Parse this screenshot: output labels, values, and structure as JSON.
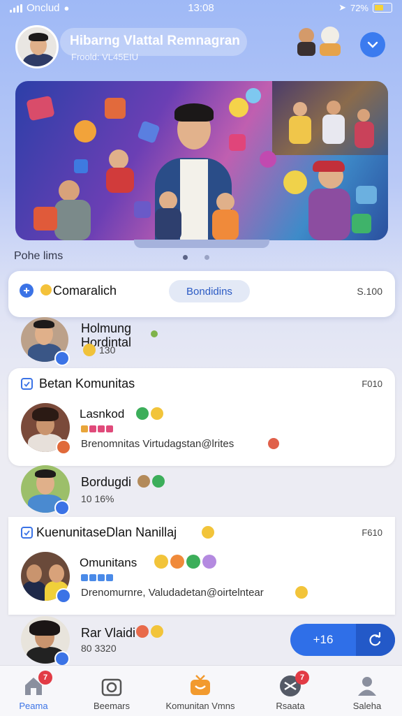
{
  "status_bar": {
    "carrier": "Onclud",
    "time": "13:08",
    "battery_text": "72%"
  },
  "header": {
    "title": "Hibarng Vlattal Remnagran",
    "subtitle": "Froold: VL45EIU"
  },
  "banner": {
    "page_label": "Pohe lims",
    "active_dot": 0,
    "dot_count": 2
  },
  "search_row": {
    "label": "Comaralich",
    "button_label": "Bondidins",
    "count": "S.100"
  },
  "rows": [
    {
      "kind": "person",
      "name": "Holmung Hordintal",
      "meta": "130"
    },
    {
      "kind": "card",
      "header": "Betan Komunitas",
      "header_count": "F010",
      "person": "Lasnkod",
      "desc": "Brenomnitas Virtudagstan@lrites"
    },
    {
      "kind": "person",
      "name": "Bordugdi",
      "meta": "10 16%"
    },
    {
      "kind": "card",
      "header": "KuenunitaseDlan Nanillaj",
      "header_count": "F610",
      "person": "Omunitans",
      "desc": "Drenomurnre, Valudadetan@oirtelntear"
    },
    {
      "kind": "person",
      "name": "Rar Vlaidi",
      "meta": "80 3320"
    }
  ],
  "fab": {
    "label": "+16"
  },
  "nav": [
    {
      "label": "Peama",
      "badge": "7",
      "active": true
    },
    {
      "label": "Beemars",
      "badge": ""
    },
    {
      "label": "Komunitan Vmns",
      "badge": ""
    },
    {
      "label": "Rsaata",
      "badge": "7"
    },
    {
      "label": "Saleha",
      "badge": ""
    }
  ],
  "colors": {
    "accent": "#2f6fe8",
    "badge": "#e23b45",
    "nav_active": "#3b73e6"
  }
}
